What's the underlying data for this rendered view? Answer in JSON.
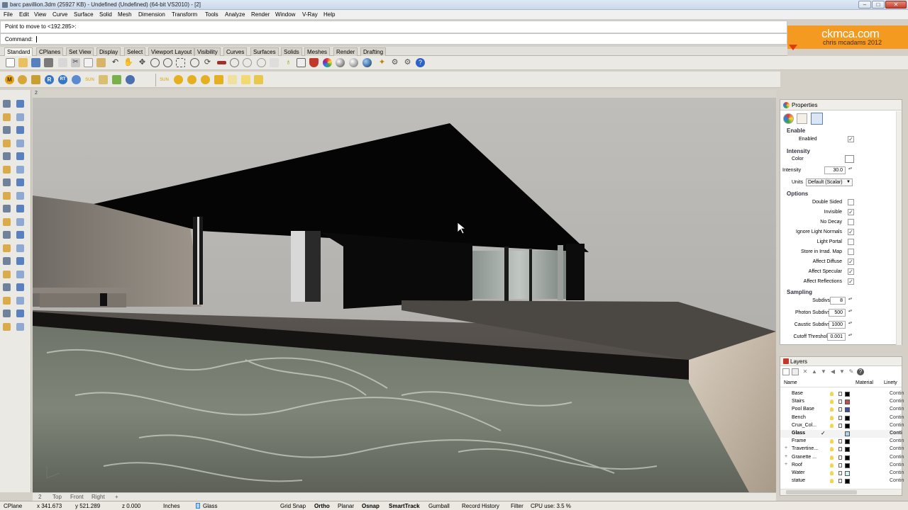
{
  "window": {
    "title": "barc pavillion.3dm (25927 KB) - Undefined (Undefined) (64-bit VS2010) - [2]"
  },
  "menu": [
    "File",
    "Edit",
    "View",
    "Curve",
    "Surface",
    "Solid",
    "Mesh",
    "Dimension",
    "Transform",
    "Tools",
    "Analyze",
    "Render",
    "Window",
    "V-Ray",
    "Help"
  ],
  "command": {
    "history": "Point to move to <192.285>:",
    "prompt": "Command:"
  },
  "logo": {
    "line1": "ckmca.com",
    "line2": "chris mcadams 2012"
  },
  "toolbar_tabs": [
    "Standard",
    "CPlanes",
    "Set View",
    "Display",
    "Select",
    "Viewport Layout",
    "Visibility",
    "Curves",
    "Surfaces",
    "Solids",
    "Meshes",
    "Render",
    "Drafting"
  ],
  "viewport": {
    "label": "2",
    "tabs": [
      "2",
      "Top",
      "Front",
      "Right"
    ],
    "add_tab": "+"
  },
  "properties": {
    "title": "Properties",
    "sections": {
      "enable": "Enable",
      "intensity": "Intensity",
      "options": "Options",
      "sampling": "Sampling"
    },
    "enabled_label": "Enabled",
    "color_label": "Color",
    "intensity_label": "Intensity",
    "intensity_value": "30.0",
    "units_label": "Units",
    "units_value": "Default (Scalar)",
    "options": [
      {
        "label": "Double Sided",
        "checked": false
      },
      {
        "label": "Invisible",
        "checked": true
      },
      {
        "label": "No Decay",
        "checked": false
      },
      {
        "label": "Ignore Light Normals",
        "checked": true
      },
      {
        "label": "Light Portal",
        "checked": false
      },
      {
        "label": "Store in Irrad. Map",
        "checked": false
      },
      {
        "label": "Affect Diffuse",
        "checked": true
      },
      {
        "label": "Affect Specular",
        "checked": true
      },
      {
        "label": "Affect Reflections",
        "checked": true
      }
    ],
    "sampling": [
      {
        "label": "Subdivs",
        "value": "8"
      },
      {
        "label": "Photon Subdivs",
        "value": "500"
      },
      {
        "label": "Caustic Subdivs",
        "value": "1000"
      },
      {
        "label": "Cutoff Threshold",
        "value": "0.001"
      }
    ]
  },
  "layers": {
    "title": "Layers",
    "columns": {
      "name": "Name",
      "material": "Material",
      "linetype": "Linety"
    },
    "items": [
      {
        "name": "Base",
        "color": "#000000",
        "linetype": "Contin",
        "current": false,
        "expand": ""
      },
      {
        "name": "Stairs",
        "color": "#c0504d",
        "linetype": "Contin",
        "current": false,
        "expand": ""
      },
      {
        "name": "Pool Base",
        "color": "#3f4fa8",
        "linetype": "Contin",
        "current": false,
        "expand": ""
      },
      {
        "name": "Bench",
        "color": "#000000",
        "linetype": "Contin",
        "current": false,
        "expand": ""
      },
      {
        "name": "Crux_Col...",
        "color": "#000000",
        "linetype": "Contin",
        "current": false,
        "expand": ""
      },
      {
        "name": "Glass",
        "color": "#a8d4f0",
        "linetype": "Conti",
        "current": true,
        "expand": ""
      },
      {
        "name": "Frame",
        "color": "#000000",
        "linetype": "Contin",
        "current": false,
        "expand": ""
      },
      {
        "name": "Travertine...",
        "color": "#000000",
        "linetype": "Contin",
        "current": false,
        "expand": "+"
      },
      {
        "name": "Granette ...",
        "color": "#000000",
        "linetype": "Contin",
        "current": false,
        "expand": "+"
      },
      {
        "name": "Roof",
        "color": "#000000",
        "linetype": "Contin",
        "current": false,
        "expand": "+"
      },
      {
        "name": "Water",
        "color": "#c8f4f4",
        "linetype": "Contin",
        "current": false,
        "expand": ""
      },
      {
        "name": "statue",
        "color": "#000000",
        "linetype": "Contin",
        "current": false,
        "expand": ""
      }
    ],
    "current_mark": "✓"
  },
  "status": {
    "cplane": "CPlane",
    "x": "x 341.673",
    "y": "y 521.289",
    "z": "z 0.000",
    "units": "Inches",
    "layer": "Glass",
    "grid_snap": "Grid Snap",
    "ortho": "Ortho",
    "planar": "Planar",
    "osnap": "Osnap",
    "smarttrack": "SmartTrack",
    "gumball": "Gumball",
    "record_history": "Record History",
    "filter": "Filter",
    "cpu": "CPU use: 3.5 %"
  },
  "icons": [
    "app-icon",
    "new-icon",
    "open-icon",
    "save-icon",
    "print-icon",
    "cut-icon",
    "copy-icon",
    "paste-icon",
    "undo-icon",
    "pan-icon",
    "zoom-icon",
    "rotate-icon",
    "light-icon",
    "lock-icon",
    "color-wheel-icon",
    "render-sphere-icon",
    "help-icon",
    "vray-icon",
    "point-icon",
    "line-icon",
    "arc-icon",
    "rectangle-icon",
    "box-icon",
    "sphere-icon",
    "checkmark-icon",
    "properties-icon",
    "layers-icon"
  ]
}
